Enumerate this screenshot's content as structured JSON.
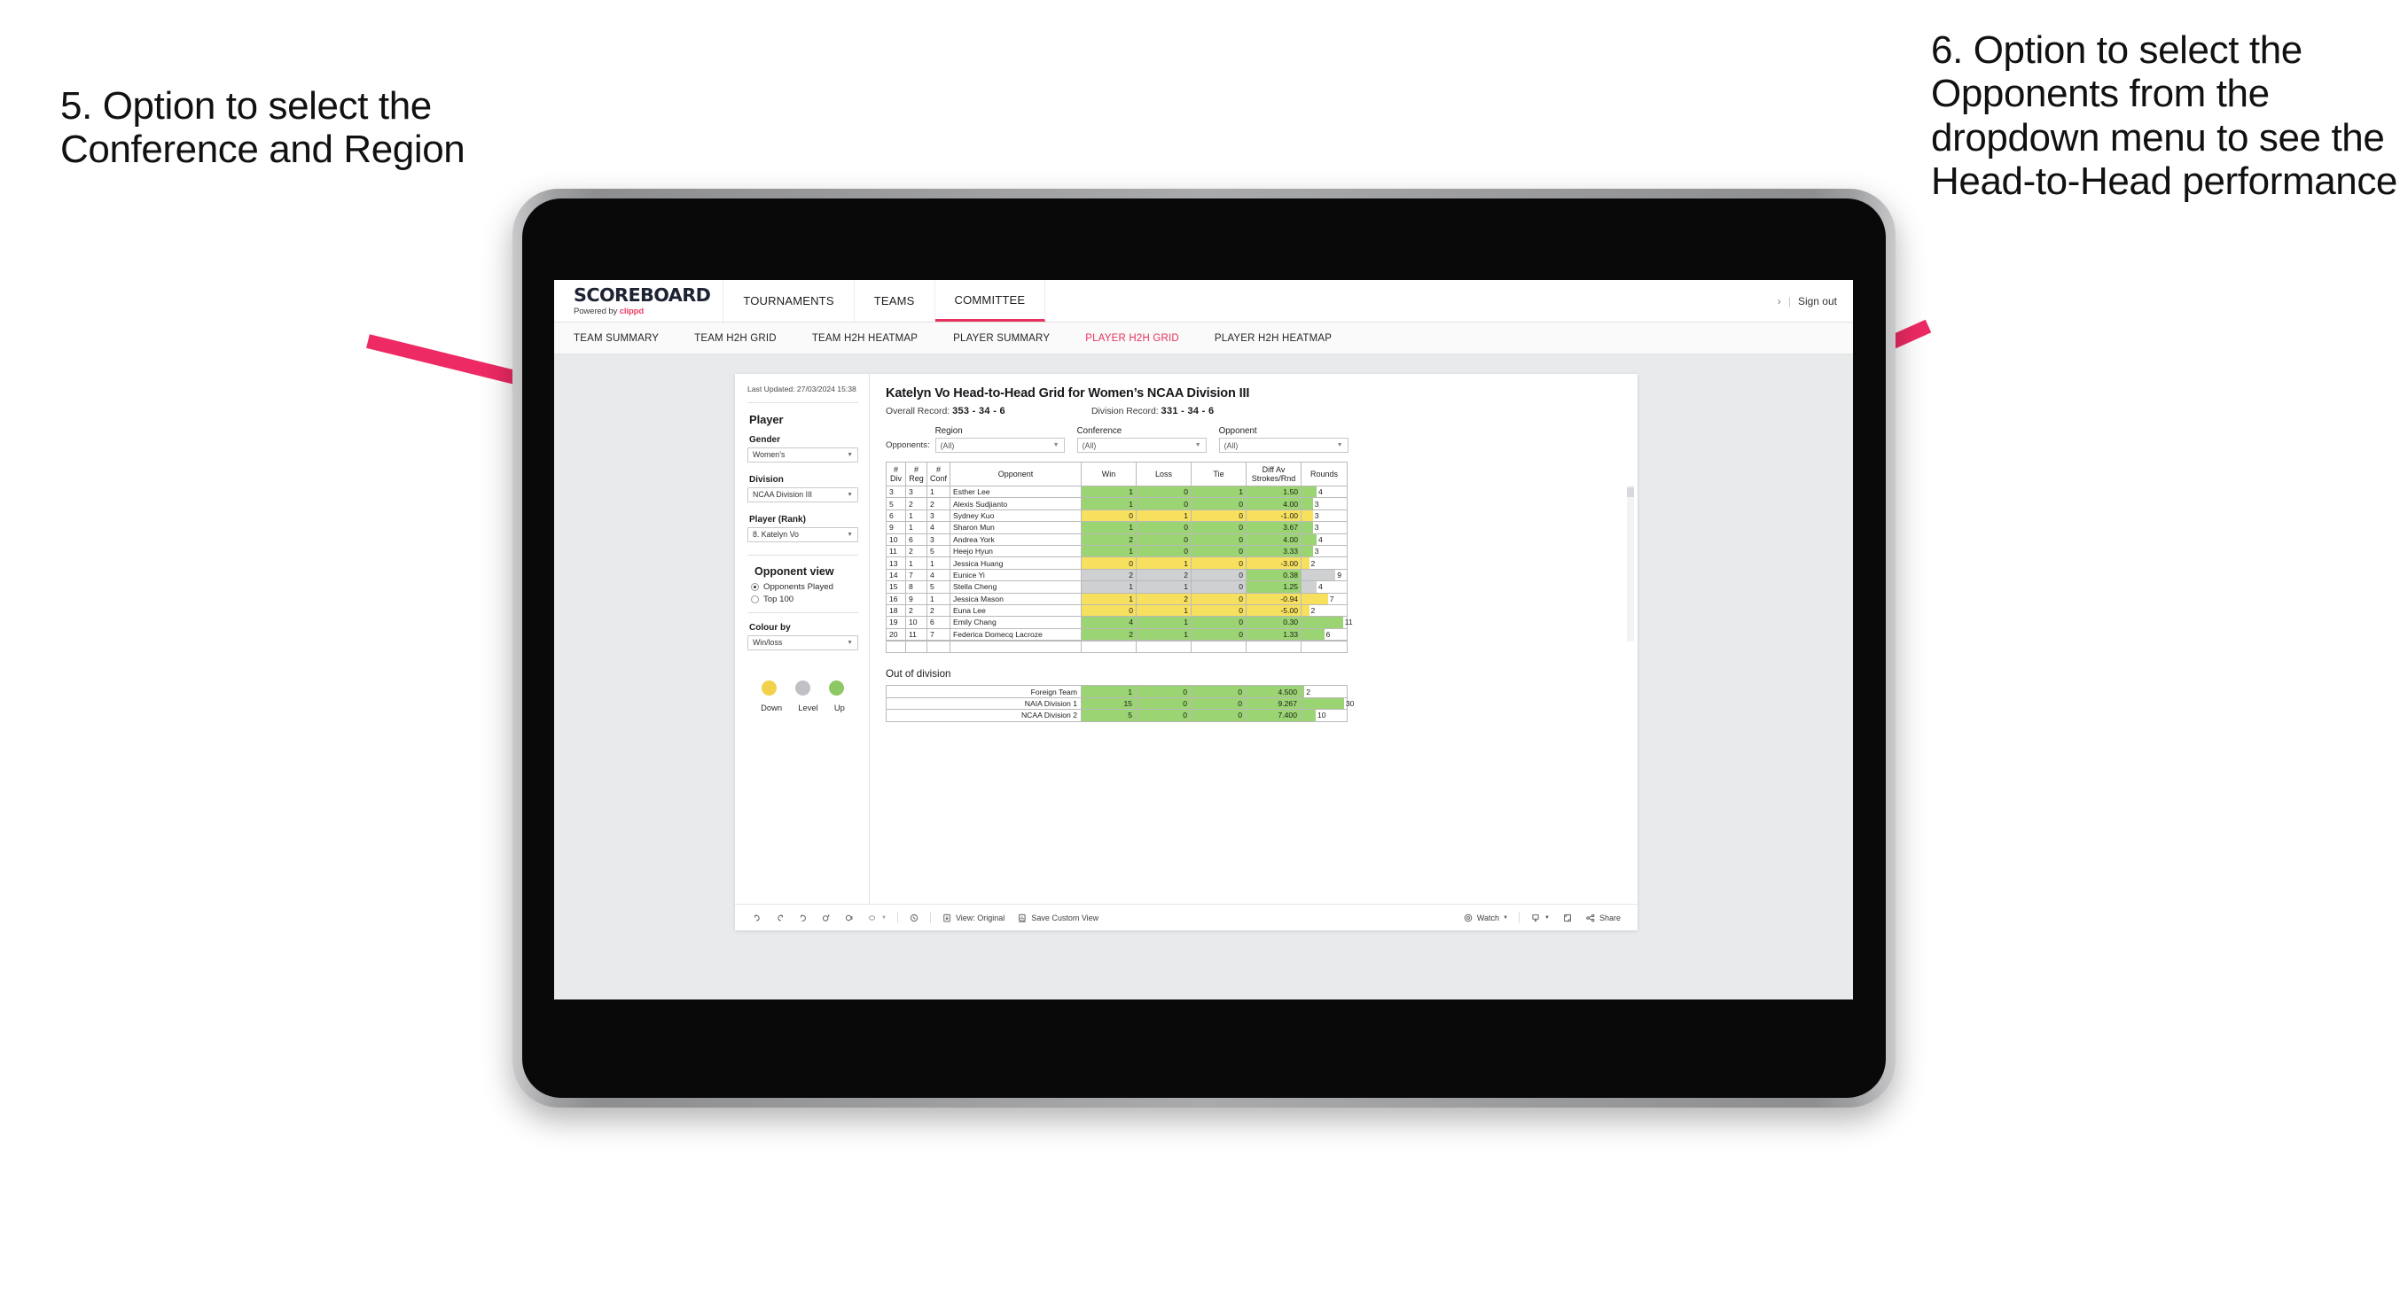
{
  "annotations": {
    "left": "5. Option to select the Conference and Region",
    "right": "6. Option to select the Opponents from the dropdown menu to see the Head-to-Head performance",
    "arrow_color": "#ed2a63"
  },
  "header": {
    "brand_word": "SCOREBOARD",
    "brand_sub_prefix": "Powered by ",
    "brand_sub_brand": "clippd",
    "nav": [
      {
        "label": "TOURNAMENTS",
        "active": false
      },
      {
        "label": "TEAMS",
        "active": false
      },
      {
        "label": "COMMITTEE",
        "active": true
      }
    ],
    "chevron": "›",
    "divider": "|",
    "sign_out": "Sign out"
  },
  "subnav": [
    {
      "label": "TEAM SUMMARY",
      "active": false
    },
    {
      "label": "TEAM H2H GRID",
      "active": false
    },
    {
      "label": "TEAM H2H HEATMAP",
      "active": false
    },
    {
      "label": "PLAYER SUMMARY",
      "active": false
    },
    {
      "label": "PLAYER H2H GRID",
      "active": true
    },
    {
      "label": "PLAYER H2H HEATMAP",
      "active": false
    }
  ],
  "sidebar": {
    "last_updated": "Last Updated: 27/03/2024 15:38",
    "player_heading": "Player",
    "fields": [
      {
        "label": "Gender",
        "value": "Women’s"
      },
      {
        "label": "Division",
        "value": "NCAA Division III"
      },
      {
        "label": "Player (Rank)",
        "value": "8. Katelyn Vo"
      }
    ],
    "opponent_view": {
      "heading": "Opponent view",
      "options": [
        {
          "label": "Opponents Played",
          "selected": true
        },
        {
          "label": "Top 100",
          "selected": false
        }
      ]
    },
    "colour_by": {
      "label": "Colour by",
      "value": "Win/loss"
    },
    "legend": [
      {
        "label": "Down",
        "color": "#f2d14b"
      },
      {
        "label": "Level",
        "color": "#bfc1c4"
      },
      {
        "label": "Up",
        "color": "#8cc863"
      }
    ]
  },
  "main": {
    "title": "Katelyn Vo Head-to-Head Grid for Women’s NCAA Division III",
    "overall_record_label": "Overall Record: ",
    "overall_record_value": "353 - 34 - 6",
    "division_record_label": "Division Record: ",
    "division_record_value": "331 - 34 - 6",
    "opponents_label": "Opponents:",
    "filters": [
      {
        "name": "Region",
        "value": "(All)"
      },
      {
        "name": "Conference",
        "value": "(All)"
      },
      {
        "name": "Opponent",
        "value": "(All)"
      }
    ],
    "table": {
      "columns": [
        "# Div",
        "# Reg",
        "# Conf",
        "Opponent",
        "Win",
        "Loss",
        "Tie",
        "Diff Av Strokes/Rnd",
        "Rounds"
      ],
      "rows": [
        {
          "div": "3",
          "reg": "3",
          "conf": "1",
          "opponent": "Esther Lee",
          "win": "1",
          "loss": "0",
          "tie": "1",
          "diff": "1.50",
          "rounds": "4",
          "state": "up"
        },
        {
          "div": "5",
          "reg": "2",
          "conf": "2",
          "opponent": "Alexis Sudjianto",
          "win": "1",
          "loss": "0",
          "tie": "0",
          "diff": "4.00",
          "rounds": "3",
          "state": "up"
        },
        {
          "div": "6",
          "reg": "1",
          "conf": "3",
          "opponent": "Sydney Kuo",
          "win": "0",
          "loss": "1",
          "tie": "0",
          "diff": "-1.00",
          "rounds": "3",
          "state": "down"
        },
        {
          "div": "9",
          "reg": "1",
          "conf": "4",
          "opponent": "Sharon Mun",
          "win": "1",
          "loss": "0",
          "tie": "0",
          "diff": "3.67",
          "rounds": "3",
          "state": "up"
        },
        {
          "div": "10",
          "reg": "6",
          "conf": "3",
          "opponent": "Andrea York",
          "win": "2",
          "loss": "0",
          "tie": "0",
          "diff": "4.00",
          "rounds": "4",
          "state": "up"
        },
        {
          "div": "11",
          "reg": "2",
          "conf": "5",
          "opponent": "Heejo Hyun",
          "win": "1",
          "loss": "0",
          "tie": "0",
          "diff": "3.33",
          "rounds": "3",
          "state": "up"
        },
        {
          "div": "13",
          "reg": "1",
          "conf": "1",
          "opponent": "Jessica Huang",
          "win": "0",
          "loss": "1",
          "tie": "0",
          "diff": "-3.00",
          "rounds": "2",
          "state": "down"
        },
        {
          "div": "14",
          "reg": "7",
          "conf": "4",
          "opponent": "Eunice Yi",
          "win": "2",
          "loss": "2",
          "tie": "0",
          "diff": "0.38",
          "rounds": "9",
          "state": "level",
          "diff_state": "up"
        },
        {
          "div": "15",
          "reg": "8",
          "conf": "5",
          "opponent": "Stella Cheng",
          "win": "1",
          "loss": "1",
          "tie": "0",
          "diff": "1.25",
          "rounds": "4",
          "state": "level",
          "diff_state": "up"
        },
        {
          "div": "16",
          "reg": "9",
          "conf": "1",
          "opponent": "Jessica Mason",
          "win": "1",
          "loss": "2",
          "tie": "0",
          "diff": "-0.94",
          "rounds": "7",
          "state": "down"
        },
        {
          "div": "18",
          "reg": "2",
          "conf": "2",
          "opponent": "Euna Lee",
          "win": "0",
          "loss": "1",
          "tie": "0",
          "diff": "-5.00",
          "rounds": "2",
          "state": "down"
        },
        {
          "div": "19",
          "reg": "10",
          "conf": "6",
          "opponent": "Emily Chang",
          "win": "4",
          "loss": "1",
          "tie": "0",
          "diff": "0.30",
          "rounds": "11",
          "state": "up"
        },
        {
          "div": "20",
          "reg": "11",
          "conf": "7",
          "opponent": "Federica Domecq Lacroze",
          "win": "2",
          "loss": "1",
          "tie": "0",
          "diff": "1.33",
          "rounds": "6",
          "state": "up"
        }
      ],
      "max_rounds": 12
    },
    "out_of_division": {
      "heading": "Out of division",
      "rows": [
        {
          "name": "Foreign Team",
          "win": "1",
          "loss": "0",
          "tie": "0",
          "diff": "4.500",
          "rounds": "2",
          "state": "up"
        },
        {
          "name": "NAIA Division 1",
          "win": "15",
          "loss": "0",
          "tie": "0",
          "diff": "9.267",
          "rounds": "30",
          "state": "up"
        },
        {
          "name": "NCAA Division 2",
          "win": "5",
          "loss": "0",
          "tie": "0",
          "diff": "7.400",
          "rounds": "10",
          "state": "up"
        }
      ],
      "max_rounds": 32
    }
  },
  "toolbar": {
    "view_label": "View: Original",
    "save_label": "Save Custom View",
    "watch_label": "Watch",
    "share_label": "Share"
  },
  "colors": {
    "accent": "#e8315c",
    "up": "#9bd472",
    "down": "#f6e05e",
    "level": "#cfd0d2"
  }
}
